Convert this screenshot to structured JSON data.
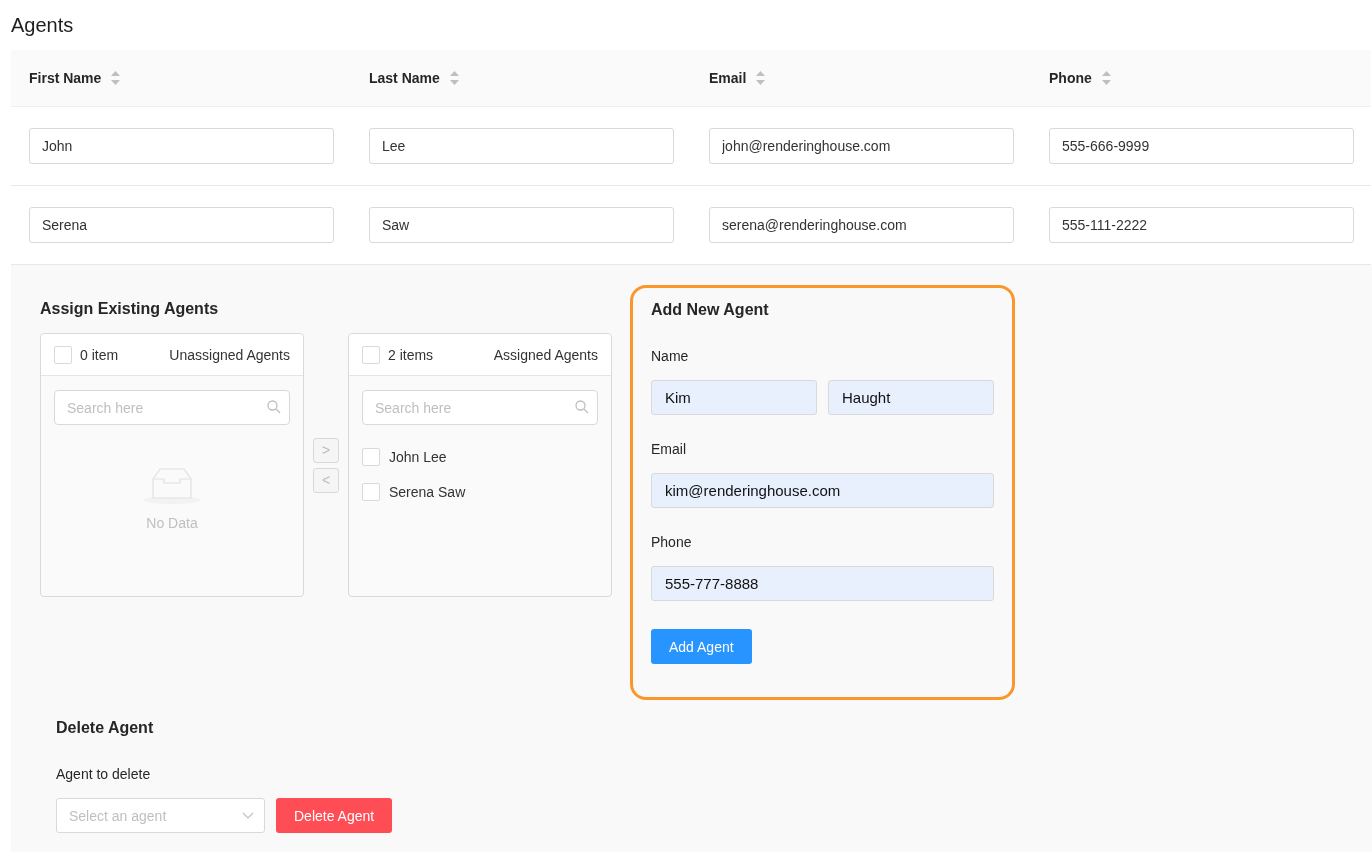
{
  "title": "Agents",
  "table": {
    "columns": [
      {
        "label": "First Name"
      },
      {
        "label": "Last Name"
      },
      {
        "label": "Email"
      },
      {
        "label": "Phone"
      }
    ],
    "rows": [
      [
        "John",
        "Lee",
        "john@renderinghouse.com",
        "555-666-9999"
      ],
      [
        "Serena",
        "Saw",
        "serena@renderinghouse.com",
        "555-111-2222"
      ]
    ]
  },
  "assign": {
    "title": "Assign Existing Agents",
    "lists": [
      {
        "count": "0 item",
        "title": "Unassigned Agents",
        "checked": false,
        "search_placeholder": "Search here",
        "empty_text": "No Data"
      },
      {
        "count": "2 items",
        "title": "Assigned Agents",
        "checked": false,
        "search_placeholder": "Search here",
        "items": [
          {
            "label": "John Lee",
            "checked": false
          },
          {
            "label": "Serena Saw",
            "checked": false
          }
        ]
      }
    ],
    "move_right": ">",
    "move_left": "<"
  },
  "add_agent": {
    "title": "Add New Agent",
    "highlighted": true,
    "fields": [
      {
        "label": "Name",
        "values": [
          "Kim",
          "Haught"
        ]
      },
      {
        "label": "Email",
        "values": [
          "kim@renderinghouse.com"
        ]
      },
      {
        "label": "Phone",
        "values": [
          "555-777-8888"
        ]
      }
    ],
    "button": "Add Agent"
  },
  "delete_agent": {
    "title": "Delete Agent",
    "label": "Agent to delete",
    "placeholder": "Select an agent",
    "button": "Delete Agent"
  }
}
